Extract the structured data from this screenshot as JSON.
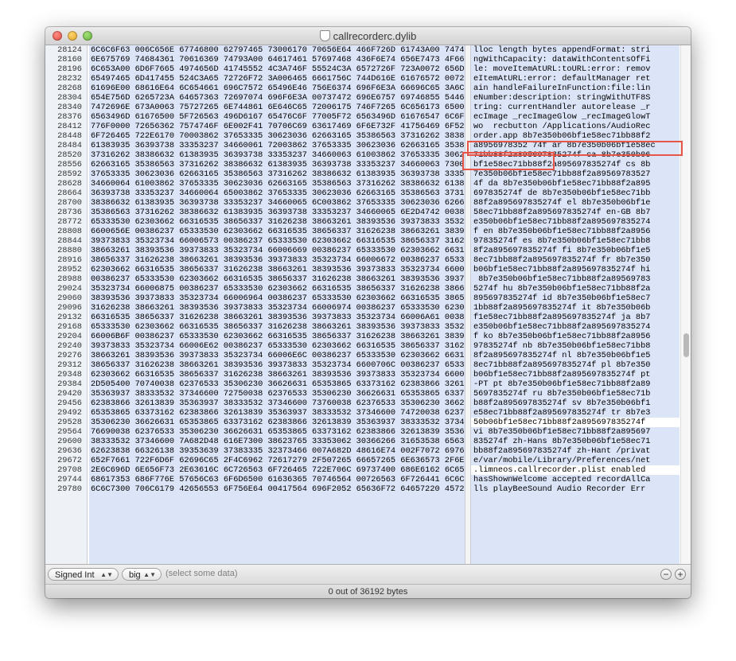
{
  "window": {
    "title": "callrecorderc.dylib"
  },
  "offsets": [
    "28124",
    "28160",
    "28196",
    "28232",
    "28268",
    "28304",
    "28340",
    "28376",
    "28412",
    "28448",
    "28484",
    "28520",
    "28556",
    "28592",
    "28628",
    "28664",
    "28700",
    "28736",
    "28772",
    "28808",
    "28844",
    "28880",
    "28916",
    "28952",
    "28988",
    "29024",
    "29060",
    "29096",
    "29132",
    "29168",
    "29204",
    "29240",
    "29276",
    "29312",
    "29348",
    "29384",
    "29420",
    "29456",
    "29492",
    "29528",
    "29564",
    "29600",
    "29636",
    "29672",
    "29708",
    "29744",
    "29780"
  ],
  "hex_rows": [
    "6C6C6F63 006C656E 67746800 62797465 73006170 70656E64 466F726D 61743A00 74747269",
    "6E675769 74684361 70616369 74793A00 64617461 57697468 436F6E74 656E7473 4F664669",
    "6C653A00 6D6F7665 4974656D 41745552 4C3A746F 55524C3A 6572726F 723A0072 656D6F76",
    "65497465 6D417455 524C3A65 72726F72 3A006465 6661756C 744D616E 61676572 00726574",
    "61696E00 68616E64 6C654661 696C7572 65496E46 756E6374 696F6E3A 66696C65 3A6C696E",
    "654E756D 6265723A 64657363 72697074 696F6E3A 00737472 696E6757 69746855 54463853",
    "7472696E 673A0063 75727265 6E744861 6E646C65 72006175 746F7265 6C656173 65005F72",
    "6563496D 61676500 5F726563 496D6167 65476C6F 77005F72 6563496D 61676547 6C6F7754",
    "776F0000 72656362 7574746F 6E002F41 70706C69 63617469 6F6E732F 41756469 6F526563",
    "6F726465 722E6170 70003862 37653335 30623036 62663165 35386563 37316262 38386632",
    "61383935 36393738 33353237 34660061 72003862 37653335 30623036 62663165 35386563",
    "37316262 38386632 61383935 36393738 33353237 34660063 61003862 37653335 30623036",
    "62663165 35386563 37316262 38386632 61383935 36393738 33353237 34660063 73003862",
    "37653335 30623036 62663165 35386563 37316262 38386632 61383935 36393738 33353237",
    "34660064 61003862 37653335 30623036 62663165 35386563 37316262 38386632 61383935",
    "36393738 33353237 34660064 65003862 37653335 30623036 62663165 35386563 37316262",
    "38386632 61383935 36393738 33353237 34660065 6C003862 37653335 30623036 62663165",
    "35386563 37316262 38386632 61383935 36393738 33353237 34660065 6E2D4742 00386237",
    "65333530 62303662 66316535 38656337 31626238 38663261 38393536 39373833 35323734",
    "6600656E 00386237 65333530 62303662 66316535 38656337 31626238 38663261 38393536",
    "39373833 35323734 66006573 00386237 65333530 62303662 66316535 38656337 31626238",
    "38663261 38393536 39373833 35323734 66006669 00386237 65333530 62303662 66316535",
    "38656337 31626238 38663261 38393536 39373833 35323734 66006672 00386237 65333530",
    "62303662 66316535 38656337 31626238 38663261 38393536 39373833 35323734 66006869",
    "00386237 65333530 62303662 66316535 38656337 31626238 38663261 38393536 39373833",
    "35323734 66006875 00386237 65333530 62303662 66316535 38656337 31626238 38663261",
    "38393536 39373833 35323734 66006964 00386237 65333530 62303662 66316535 38656337",
    "31626238 38663261 38393536 39373833 35323734 66006974 00386237 65333530 62303662",
    "66316535 38656337 31626238 38663261 38393536 39373833 35323734 66006A61 00386237",
    "65333530 62303662 66316535 38656337 31626238 38663261 38393536 39373833 35323734",
    "66006B6F 00386237 65333530 62303662 66316535 38656337 31626238 38663261 38393536",
    "39373833 35323734 66006E62 00386237 65333530 62303662 66316535 38656337 31626238",
    "38663261 38393536 39373833 35323734 66006E6C 00386237 65333530 62303662 66316535",
    "38656337 31626238 38663261 38393536 39373833 35323734 6600706C 00386237 65333530",
    "62303662 66316535 38656337 31626238 38663261 38393536 39373833 35323734 66007074",
    "2D505400 70740038 62376533 35306230 36626631 65353865 63373162 62383866 32613839",
    "35363937 38333532 37346600 72750038 62376533 35306230 36626631 65353865 63373162",
    "62383866 32613839 35363937 38333532 37346600 73760038 62376533 35306230 36626631",
    "65353865 63373162 62383866 32613839 35363937 38333532 37346600 74720038 62376533",
    "35306230 36626631 65353865 63373162 62383866 32613839 35363937 38333532 37346600",
    "76690038 62376533 35306230 36626631 65353865 63373162 62383866 32613839 35363937",
    "38333532 37346600 7A682D48 616E7300 38623765 33353062 30366266 31653538 65633731",
    "62623838 66326138 39353639 37383335 32373466 007A682D 48616E74 002F7072 69766174",
    "652F7661 722F6D6F 62696C65 2F4C6962 72617279 2F507265 66657265 6E636573 2F6E6574",
    "2E6C696D 6E656F73 2E63616C 6C726563 6F726465 722E706C 69737400 686E6162 6C656400",
    "68617353 686F776E 57656C63 6F6D6500 61636365 70746564 00726563 6F726441 6C6C4361",
    "6C6C7300 706C6179 42656553 6F756E64 00417564 696F2052 65636F72 64657220 45727200"
  ],
  "ascii_rows": [
    "lloc length bytes appendFormat: stri",
    "ngWithCapacity: dataWithContentsOfFi",
    "le: moveItemAtURL:toURL:error: remov",
    "eItemAtURL:error: defaultManager ret",
    "ain handleFailureInFunction:file:lin",
    "eNumber:description: stringWithUTF8S",
    "tring: currentHandler autorelease _r",
    "ecImage _recImageGlow _recImageGlowT",
    "wo  recbutton /Applications/AudioRec",
    "order.app 8b7e350b06bf1e58ec71bb88f2",
    "a8956978352 74f ar 8b7e350b06bf1e58ec",
    "71bb88f2a895697835274f ca 8b7e350b06",
    "bf1e58ec71bb88f2a895697835274f cs 8b",
    "7e350b06bf1e58ec71bb88f2a89569783527",
    "4f da 8b7e350b06bf1e58ec71bb88f2a895",
    "697835274f de 8b7e350b06bf1e58ec71bb",
    "88f2a895697835274f el 8b7e350b06bf1e",
    "58ec71bb88f2a895697835274f en-GB 8b7",
    "e350b06bf1e58ec71bb88f2a895697835274",
    "f en 8b7e350b06bf1e58ec71bb88f2a8956",
    "97835274f es 8b7e350b06bf1e58ec71bb8",
    "8f2a895697835274f fi 8b7e350b06bf1e5",
    "8ec71bb88f2a895697835274f fr 8b7e350",
    "b06bf1e58ec71bb88f2a895697835274f hi",
    " 8b7e350b06bf1e58ec71bb88f2a89569783",
    "5274f hu 8b7e350b06bf1e58ec71bb88f2a",
    "895697835274f id 8b7e350b06bf1e58ec7",
    "1bb88f2a895697835274f it 8b7e350b06b",
    "f1e58ec71bb88f2a895697835274f ja 8b7",
    "e350b06bf1e58ec71bb88f2a895697835274",
    "f ko 8b7e350b06bf1e58ec71bb88f2a8956",
    "97835274f nb 8b7e350b06bf1e58ec71bb8",
    "8f2a895697835274f nl 8b7e350b06bf1e5",
    "8ec71bb88f2a895697835274f pl 8b7e350",
    "b06bf1e58ec71bb88f2a895697835274f pt",
    "-PT pt 8b7e350b06bf1e58ec71bb88f2a89",
    "5697835274f ru 8b7e350b06bf1e58ec71b",
    "b88f2a895697835274f sv 8b7e350b06bf1",
    "e58ec71bb88f2a895697835274f tr 8b7e3",
    "50b06bf1e58ec71bb88f2a895697835274f",
    "vi 8b7e350b06bf1e58ec71bb88f2a895697",
    "835274f zh-Hans 8b7e350b06bf1e58ec71",
    "bb88f2a895697835274f zh-Hant /privat",
    "e/var/mobile/Library/Preferences/net",
    ".limneos.callrecorder.plist enabled",
    "hasShownWelcome accepted recordAllCa",
    "lls playBeeSound Audio Recorder Err"
  ],
  "bottom": {
    "type_select": "Signed Int",
    "endian_select": "big",
    "hint": "(select some data)"
  },
  "status": "0 out of 36192 bytes",
  "colors": {
    "selection_blue": "#dce4f8",
    "highlight_red": "#e8564a"
  }
}
